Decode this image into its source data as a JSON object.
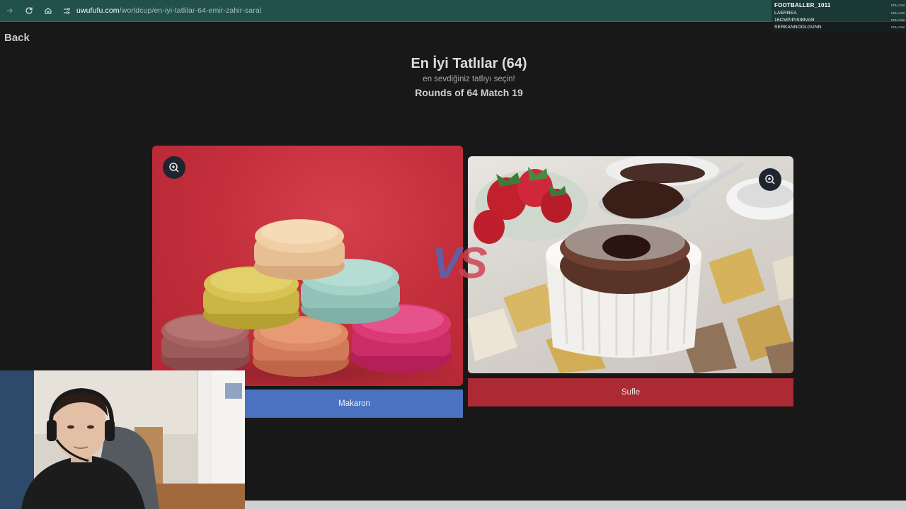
{
  "browser": {
    "url_domain": "uwufufu.com",
    "url_path": "/worldcup/en-iyi-tatlilar-64-emir-zahir-saral"
  },
  "chat": {
    "users": [
      {
        "name": "FOOTBALLER_1011",
        "action": "FOLLOW"
      },
      {
        "name": "LAERNEA",
        "action": "FOLLOW"
      },
      {
        "name": "16CMPIPISIMVAR",
        "action": "FOLLOW"
      },
      {
        "name": "SERKANNDOLGUNN",
        "action": "FOLLOW"
      }
    ]
  },
  "page": {
    "back_label": "Back",
    "title": "En İyi Tatlılar (64)",
    "subtitle": "en sevdiğiniz tatlıyı seçin!",
    "round_info": "Rounds of 64 Match 19",
    "vs_text": "VS"
  },
  "candidates": {
    "left_label": "Makaron",
    "right_label": "Sufle"
  },
  "colors": {
    "left_button": "#4a72c0",
    "right_button": "#ab2a33",
    "browser_bar": "#22504a",
    "page_background": "#181818"
  }
}
